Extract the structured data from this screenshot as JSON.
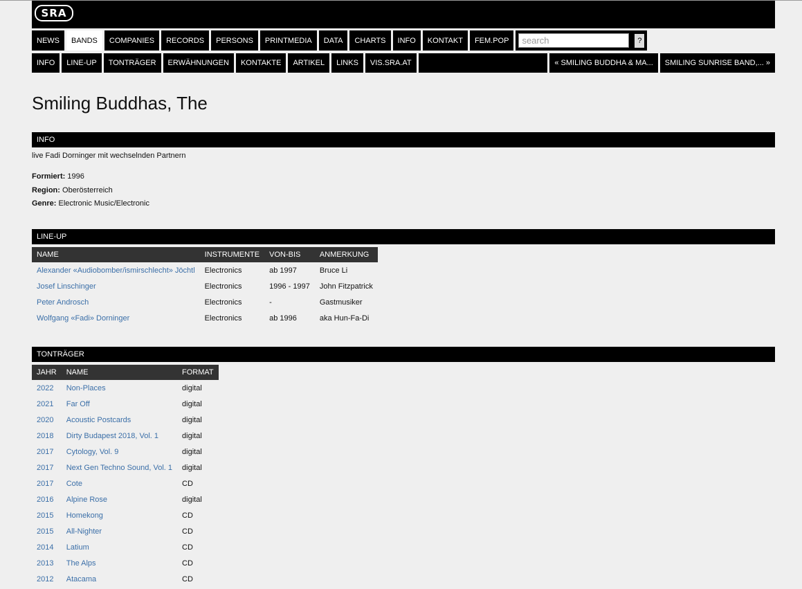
{
  "logo": "SRA",
  "nav": {
    "main": [
      "NEWS",
      "BANDS",
      "COMPANIES",
      "RECORDS",
      "PERSONS",
      "PRINTMEDIA",
      "DATA",
      "CHARTS",
      "INFO",
      "KONTAKT",
      "FEM.POP"
    ],
    "active": "BANDS",
    "search_placeholder": "search",
    "help_label": "?",
    "sub": [
      "INFO",
      "LINE-UP",
      "TONTRÄGER",
      "ERWÄHNUNGEN",
      "KONTAKTE",
      "ARTIKEL",
      "LINKS",
      "VIS.SRA.AT"
    ],
    "prev": "« SMILING BUDDHA & MA...",
    "next": "SMILING SUNRISE BAND,... »"
  },
  "title": "Smiling Buddhas, The",
  "info": {
    "header": "INFO",
    "description": "live Fadi Dorninger mit wechselnden Partnern",
    "formiert_label": "Formiert:",
    "formiert": "1996",
    "region_label": "Region:",
    "region": "Oberösterreich",
    "genre_label": "Genre:",
    "genre": "Electronic Music/Electronic"
  },
  "lineup": {
    "header": "LINE-UP",
    "columns": [
      "NAME",
      "INSTRUMENTE",
      "VON-BIS",
      "ANMERKUNG"
    ],
    "rows": [
      [
        "Alexander «Audiobomber/ismirschlecht» Jöchtl",
        "Electronics",
        "ab 1997",
        "Bruce Li"
      ],
      [
        "Josef Linschinger",
        "Electronics",
        "1996 - 1997",
        "John Fitzpatrick"
      ],
      [
        "Peter Androsch",
        "Electronics",
        "-",
        "Gastmusiker"
      ],
      [
        "Wolfgang «Fadi» Dorninger",
        "Electronics",
        "ab 1996",
        "aka Hun-Fa-Di"
      ]
    ]
  },
  "tontraeger": {
    "header": "TONTRÄGER",
    "columns": [
      "JAHR",
      "NAME",
      "FORMAT"
    ],
    "rows": [
      [
        "2022",
        "Non-Places",
        "digital"
      ],
      [
        "2021",
        "Far Off",
        "digital"
      ],
      [
        "2020",
        "Acoustic Postcards",
        "digital"
      ],
      [
        "2018",
        "Dirty Budapest 2018, Vol. 1",
        "digital"
      ],
      [
        "2017",
        "Cytology, Vol. 9",
        "digital"
      ],
      [
        "2017",
        "Next Gen Techno Sound, Vol. 1",
        "digital"
      ],
      [
        "2017",
        "Cote",
        "CD"
      ],
      [
        "2016",
        "Alpine Rose",
        "digital"
      ],
      [
        "2015",
        "Homekong",
        "CD"
      ],
      [
        "2015",
        "All-Nighter",
        "CD"
      ],
      [
        "2014",
        "Latium",
        "CD"
      ],
      [
        "2013",
        "The Alps",
        "CD"
      ],
      [
        "2012",
        "Atacama",
        "CD"
      ]
    ]
  },
  "colors": {
    "link": "#3b6fa8",
    "bar": "#000000",
    "table_header": "#333333",
    "background": "#efefef"
  }
}
